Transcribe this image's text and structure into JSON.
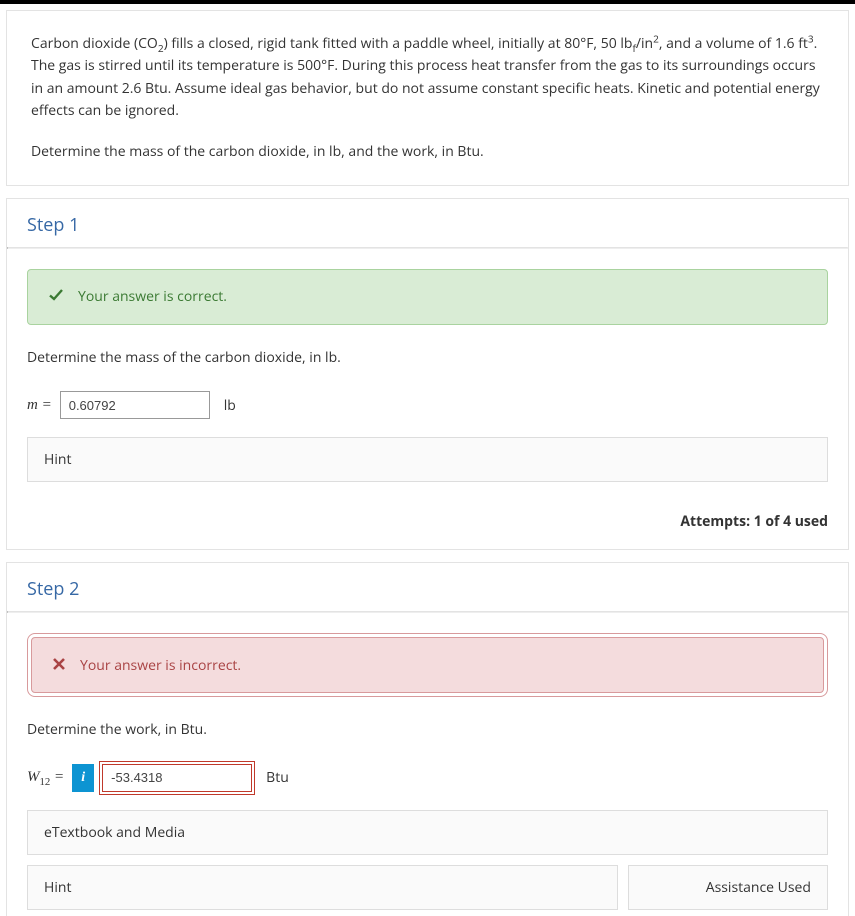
{
  "problem": {
    "paragraph1_html": "Carbon dioxide (CO<sub>2</sub>) fills a closed, rigid tank fitted with a paddle wheel, initially at 80°F, 50 lb<sub>f</sub>/in<sup>2</sup>, and a volume of 1.6 ft<sup>3</sup>. The gas is stirred until its temperature is 500°F. During this process heat transfer from the gas to its surroundings occurs in an amount 2.6 Btu. Assume ideal gas behavior, but do not assume constant specific heats. Kinetic and potential energy effects can be ignored.",
    "paragraph2": "Determine the mass of the carbon dioxide, in lb, and the work, in Btu."
  },
  "step1": {
    "title": "Step 1",
    "feedback": "Your answer is correct.",
    "question": "Determine the mass of the carbon dioxide, in lb.",
    "var_label_html": "m =",
    "value": "0.60792",
    "unit": "lb",
    "hint_label": "Hint",
    "attempts": "Attempts: 1 of 4 used"
  },
  "step2": {
    "title": "Step 2",
    "feedback": "Your answer is incorrect.",
    "question": "Determine the work, in Btu.",
    "var_label_html": "W<sub>12</sub> =",
    "info_tip": "i",
    "value": "-53.4318",
    "unit": "Btu",
    "etext_label": "eTextbook and Media",
    "hint_label": "Hint",
    "assist_label": "Assistance Used"
  }
}
